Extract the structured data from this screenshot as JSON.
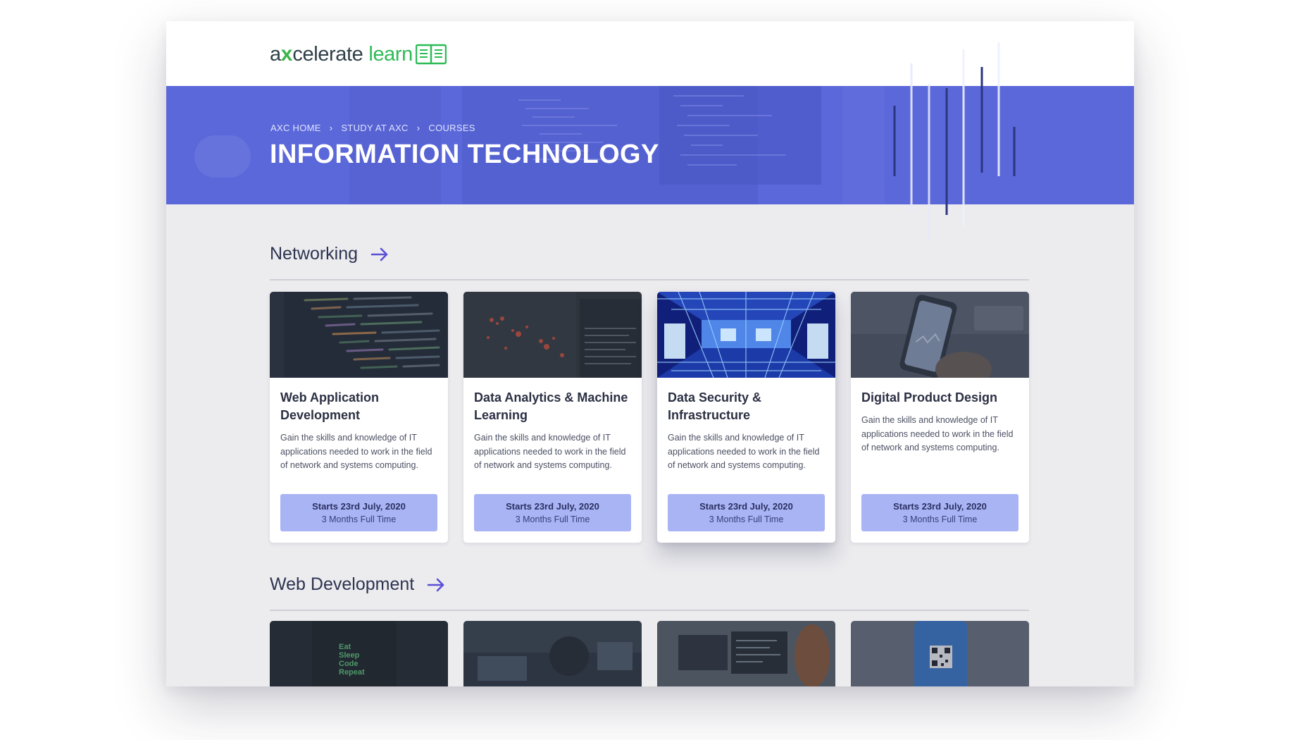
{
  "logo": {
    "part_a": "a",
    "part_x": "x",
    "part_b": "celerate",
    "part_learn": "learn"
  },
  "breadcrumb": {
    "items": [
      "AXC HOME",
      "STUDY AT AXC",
      "COURSES"
    ],
    "separator": "›"
  },
  "hero": {
    "title": "INFORMATION TECHNOLOGY",
    "background_color": "#5b68d9"
  },
  "sections": [
    {
      "title": "Networking",
      "arrow_icon": "arrow-right-icon",
      "courses": [
        {
          "title": "Web Application Development",
          "description": "Gain the skills and knowledge of IT applications needed to work in the field of network and systems computing.",
          "start": "Starts 23rd July, 2020",
          "duration": "3 Months Full Time"
        },
        {
          "title": "Data Analytics & Machine Learning",
          "description": "Gain the skills and knowledge of IT applications needed to work in the field of network and systems computing.",
          "start": "Starts 23rd July, 2020",
          "duration": "3 Months Full Time"
        },
        {
          "title": "Data Security & Infrastructure",
          "description": "Gain the skills and knowledge of IT applications needed to work in the field of network and systems computing.",
          "start": "Starts 23rd July, 2020",
          "duration": "3 Months Full Time"
        },
        {
          "title": "Digital Product Design",
          "description": "Gain the skills and knowledge of IT applications needed to work in the field of network and systems computing.",
          "start": "Starts 23rd July, 2020",
          "duration": "3 Months Full Time"
        }
      ]
    },
    {
      "title": "Web Development",
      "arrow_icon": "arrow-right-icon",
      "thumbnail_text": [
        "Eat",
        "Sleep",
        "Code",
        "Repeat"
      ]
    }
  ],
  "colors": {
    "accent": "#5b68d9",
    "badge": "#a9b4f5",
    "logo_green": "#2dbb57",
    "arrow": "#5b4fd6"
  }
}
